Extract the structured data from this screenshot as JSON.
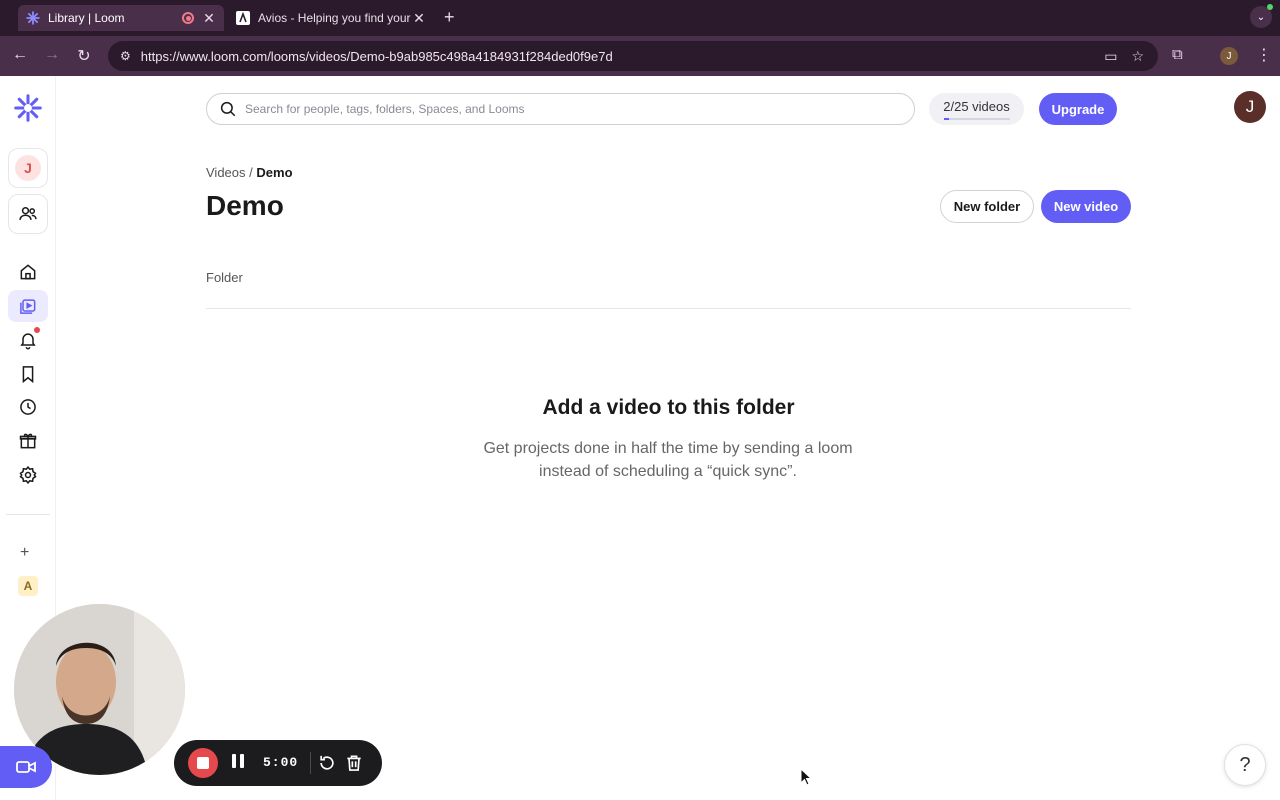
{
  "browser": {
    "tabs": [
      {
        "title": "Library | Loom",
        "active": true
      },
      {
        "title": "Avios - Helping you find your",
        "active": false
      }
    ],
    "url": "https://www.loom.com/looms/videos/Demo-b9ab985c498a4184931f284ded0f9e7d",
    "profile_initial": "J"
  },
  "sidebar": {
    "workspace_initial": "J",
    "space_initial": "A",
    "add_label": "+"
  },
  "header": {
    "search_placeholder": "Search for people, tags, folders, Spaces, and Looms",
    "quota_label": "2/25 videos",
    "quota_fraction": 0.08,
    "upgrade_label": "Upgrade",
    "user_initial": "J"
  },
  "main": {
    "breadcrumb": {
      "parent": "Videos",
      "separator": "/",
      "current": "Demo"
    },
    "title": "Demo",
    "new_folder_label": "New folder",
    "new_video_label": "New video",
    "section_label": "Folder",
    "empty_title": "Add a video to this folder",
    "empty_desc": "Get projects done in half the time by sending a loom instead of scheduling a “quick sync”."
  },
  "recorder": {
    "timer": "5:00"
  },
  "help": {
    "label": "?"
  },
  "colors": {
    "accent": "#625df5",
    "record_red": "#e5484d",
    "browser_frame": "#4a2f4b"
  }
}
